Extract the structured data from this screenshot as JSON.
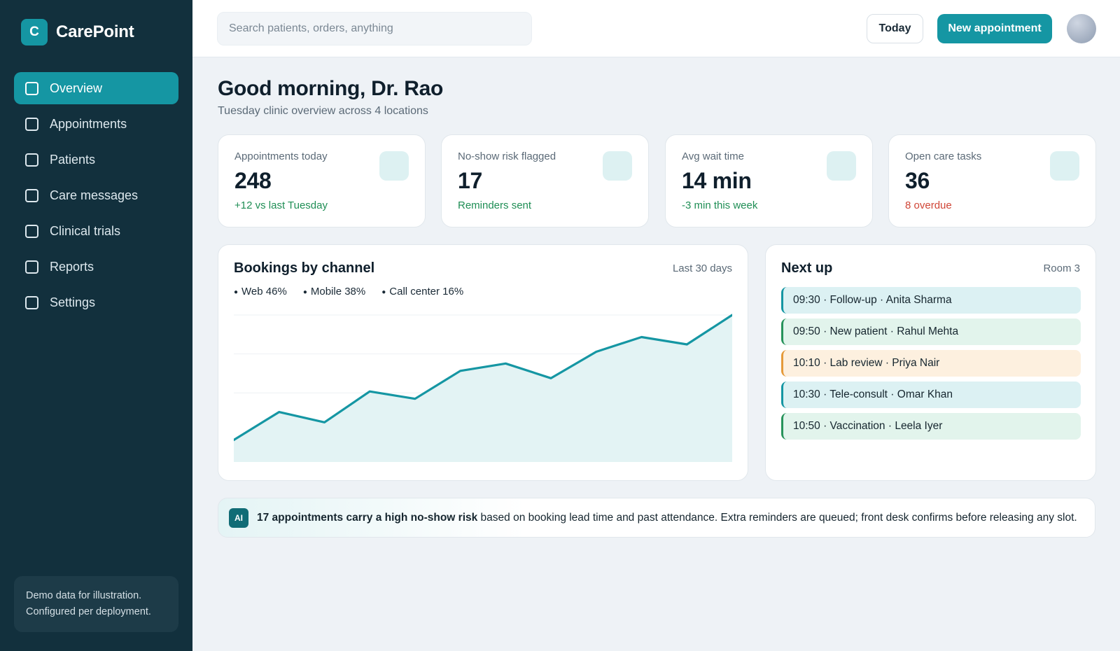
{
  "sidebar": {
    "brand": {
      "logo_letter": "C",
      "name": "CarePoint"
    },
    "nav": [
      {
        "label": "Overview",
        "active": true
      },
      {
        "label": "Appointments",
        "active": false
      },
      {
        "label": "Patients",
        "active": false
      },
      {
        "label": "Care messages",
        "active": false
      },
      {
        "label": "Clinical trials",
        "active": false
      },
      {
        "label": "Reports",
        "active": false
      },
      {
        "label": "Settings",
        "active": false
      }
    ],
    "note_line1": "Demo data for illustration.",
    "note_line2": "Configured per deployment."
  },
  "topbar": {
    "search_placeholder": "Search patients, orders, anything",
    "today_label": "Today",
    "new_appointment_label": "New appointment"
  },
  "header": {
    "greeting": "Good morning, Dr. Rao",
    "subtitle": "Tuesday clinic overview across 4 locations"
  },
  "kpis": [
    {
      "label": "Appointments today",
      "value": "248",
      "delta": "+12 vs last Tuesday",
      "tone": "good"
    },
    {
      "label": "No-show risk flagged",
      "value": "17",
      "delta": "Reminders sent",
      "tone": "good"
    },
    {
      "label": "Avg wait time",
      "value": "14 min",
      "delta": "-3 min this week",
      "tone": "good"
    },
    {
      "label": "Open care tasks",
      "value": "36",
      "delta": "8 overdue",
      "tone": "bad"
    }
  ],
  "bookings": {
    "title": "Bookings by channel",
    "range": "Last 30 days",
    "legend": [
      "Web 46%",
      "Mobile 38%",
      "Call center 16%"
    ]
  },
  "chart_data": {
    "type": "area",
    "title": "Bookings by channel",
    "x": [
      1,
      2,
      3,
      4,
      5,
      6,
      7,
      8,
      9,
      10,
      11,
      12
    ],
    "values": [
      15,
      34,
      27,
      48,
      43,
      62,
      67,
      57,
      75,
      85,
      80,
      100
    ],
    "ylim": [
      0,
      100
    ],
    "grid": true,
    "color": "#1596a3",
    "fill": "#e3f3f4"
  },
  "next_up": {
    "title": "Next up",
    "room": "Room 3",
    "items": [
      {
        "text": "09:30 · Follow-up · Anita Sharma",
        "tone": "teal"
      },
      {
        "text": "09:50 · New patient · Rahul Mehta",
        "tone": "green"
      },
      {
        "text": "10:10 · Lab review · Priya Nair",
        "tone": "amber"
      },
      {
        "text": "10:30 · Tele-consult · Omar Khan",
        "tone": "teal"
      },
      {
        "text": "10:50 · Vaccination · Leela Iyer",
        "tone": "green"
      }
    ]
  },
  "ai_banner": {
    "badge": "AI",
    "headline": "17 appointments carry a high no-show risk",
    "detail": " based on booking lead time and past attendance. Extra reminders are queued; front desk confirms before releasing any slot."
  }
}
